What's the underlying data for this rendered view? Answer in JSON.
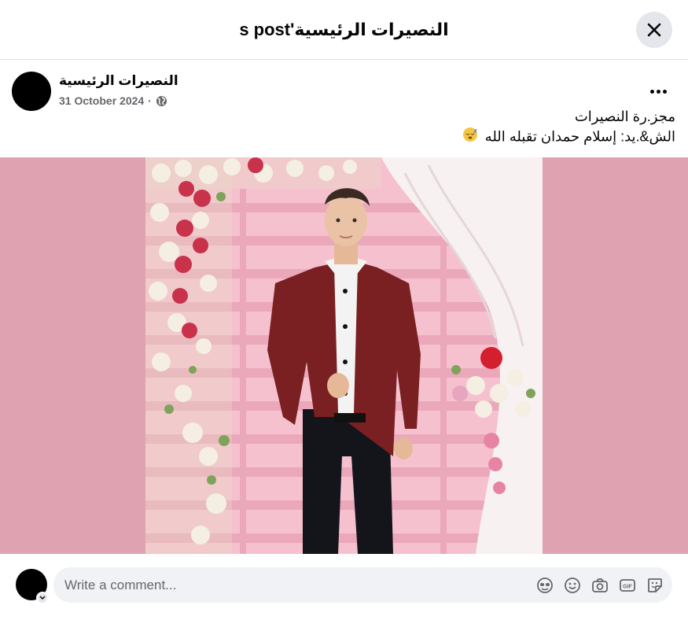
{
  "header": {
    "title": "النصيرات الرئيسية's post",
    "close_icon": "close-icon"
  },
  "post": {
    "author": "النصيرات الرئيسية",
    "date": "31 October 2024",
    "separator": "·",
    "audience_icon": "globe-icon",
    "more_icon": "more-options-icon",
    "text_lines": [
      "مجز.رة النصيرات",
      "الش&.يد: إسلام حمدان تقبله الله"
    ],
    "emoji": "sleeping-face"
  },
  "photo": {
    "alt": "photo",
    "background_color": "#dfa2b0"
  },
  "comment": {
    "placeholder": "Write a comment...",
    "icons": [
      "avatar-sticker-icon",
      "emoji-icon",
      "camera-icon",
      "gif-icon",
      "sticker-icon"
    ]
  }
}
